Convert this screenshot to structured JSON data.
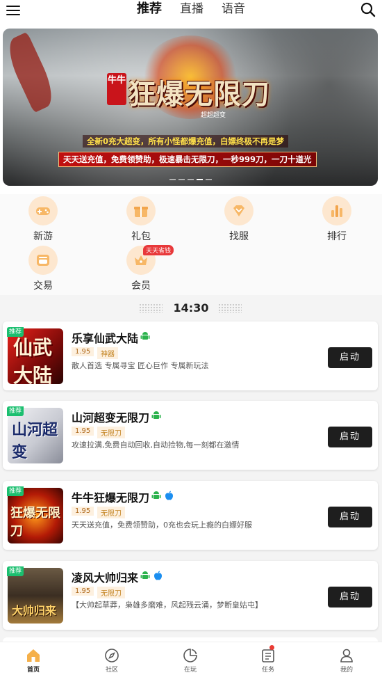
{
  "top_tabs": [
    {
      "label": "推荐",
      "active": true
    },
    {
      "label": "直播",
      "active": false
    },
    {
      "label": "语音",
      "active": false
    }
  ],
  "banner": {
    "badge": "牛牛",
    "title": "狂爆无限刀",
    "sub": "超超超变",
    "line1": "全新0充大超变，所有小怪都爆充值，白嫖终极不再是梦",
    "line2": "天天送充值，免费领赞助，极速暴击无限刀，一秒999刀，一刀十道光",
    "slide_count": 5,
    "active_slide": 3
  },
  "quick_icons": [
    {
      "label": "新游",
      "icon": "gamepad-icon"
    },
    {
      "label": "礼包",
      "icon": "gift-icon"
    },
    {
      "label": "找服",
      "icon": "diamond-icon"
    },
    {
      "label": "排行",
      "icon": "bar-chart-icon"
    },
    {
      "label": "交易",
      "icon": "trade-icon"
    },
    {
      "label": "会员",
      "icon": "crown-icon",
      "tag": "天天省钱"
    }
  ],
  "time_label": "14:30",
  "games": [
    {
      "rec": "推荐",
      "name": "乐享仙武大陆",
      "price": "1.95",
      "tag": "神器",
      "desc": "散人首选 专属寻宝 匠心巨作 专属新玩法",
      "android": true,
      "ios": false,
      "start": "启动",
      "thumb_text": "仙武大陆"
    },
    {
      "rec": "推荐",
      "name": "山河超变无限刀",
      "price": "1.95",
      "tag": "无限刀",
      "desc": "攻速拉满,免费自动回收,自动捡物,每一刻都在激情",
      "android": true,
      "ios": false,
      "start": "启动",
      "thumb_text": "山河超变"
    },
    {
      "rec": "推荐",
      "name": "牛牛狂爆无限刀",
      "price": "1.95",
      "tag": "无限刀",
      "desc": "天天送充值，免费领赞助，0充也会玩上瘾的白嫖好服",
      "android": true,
      "ios": true,
      "start": "启动",
      "thumb_text": "狂爆无限刀"
    },
    {
      "rec": "推荐",
      "name": "凌风大帅归来",
      "price": "1.95",
      "tag": "无限刀",
      "desc": "【大帅起草莽，枭雄多磨难，风起残云涌，梦断皇姑屯】",
      "android": true,
      "ios": true,
      "start": "启动",
      "thumb_text": "大帅归来"
    }
  ],
  "bottom_nav": [
    {
      "label": "首页",
      "icon": "home-icon",
      "active": true
    },
    {
      "label": "社区",
      "icon": "compass-icon",
      "active": false
    },
    {
      "label": "在玩",
      "icon": "play-icon",
      "active": false
    },
    {
      "label": "任务",
      "icon": "task-list-icon",
      "active": false,
      "badge": true
    },
    {
      "label": "我的",
      "icon": "profile-icon",
      "active": false
    }
  ],
  "colors": {
    "accent": "#f5a623",
    "rec_green": "#1bbf6f",
    "start_bg": "#1e1e1e",
    "badge_red": "#e8383a"
  }
}
